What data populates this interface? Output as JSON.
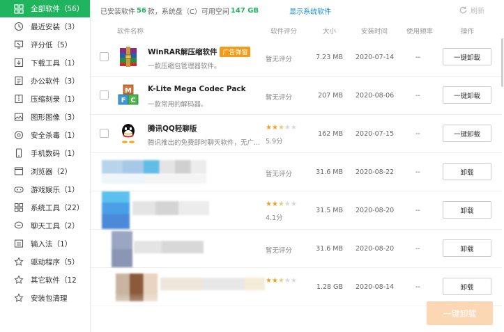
{
  "sidebar": {
    "items": [
      {
        "label": "全部软件（56）",
        "icon": "grid-icon",
        "active": true
      },
      {
        "label": "最近安装（3）",
        "icon": "clock-icon"
      },
      {
        "label": "评分低（5）",
        "icon": "thumb-down-icon"
      },
      {
        "label": "下载工具（1）",
        "icon": "download-icon"
      },
      {
        "label": "办公软件（3）",
        "icon": "briefcase-icon"
      },
      {
        "label": "压缩刻录（1）",
        "icon": "archive-icon"
      },
      {
        "label": "图形图像（3）",
        "icon": "image-icon"
      },
      {
        "label": "安全杀毒（1）",
        "icon": "shield-icon"
      },
      {
        "label": "手机数码（1）",
        "icon": "phone-icon"
      },
      {
        "label": "浏览器（2）",
        "icon": "browser-icon"
      },
      {
        "label": "游戏娱乐（1）",
        "icon": "gamepad-icon"
      },
      {
        "label": "系统工具（22）",
        "icon": "tools-icon"
      },
      {
        "label": "聊天工具（2）",
        "icon": "chat-icon"
      },
      {
        "label": "输入法（1）",
        "icon": "keyboard-icon"
      },
      {
        "label": "驱动程序（5）",
        "icon": "star-icon"
      },
      {
        "label": "其它软件（12",
        "icon": "star-icon"
      },
      {
        "label": "安装包清理",
        "icon": "star-icon"
      }
    ]
  },
  "topbar": {
    "prefix": "已安装软件",
    "count": "56",
    "mid": "款，系统盘（C）可用空间",
    "free_space": "147 GB",
    "show_system_link": "显示系统软件",
    "refresh_label": "刷新"
  },
  "table": {
    "headers": {
      "name": "软件名称",
      "rating": "软件评分",
      "size": "大小",
      "install_date": "安装时间",
      "frequency": "使用频率",
      "action": "操作"
    },
    "rows": [
      {
        "name": "WinRAR解压缩软件",
        "badge": "广告弹窗",
        "desc": "一款压缩包管理器软件。",
        "rating": "暂无评分",
        "size": "7.23 MB",
        "date": "2020-07-14",
        "freq": "--",
        "action": "一键卸载",
        "icon": "winrar-icon"
      },
      {
        "name": "K-Lite Mega Codec Pack",
        "desc": "一款常用的解码器。",
        "rating": "暂无评分",
        "size": "207 MB",
        "date": "2020-08-06",
        "freq": "--",
        "action": "一键卸载",
        "icon": "klite-icon"
      },
      {
        "name": "腾讯QQ轻聊版",
        "desc": "腾讯推出的免费即时聊天软件，无广...",
        "stars": 2.5,
        "score": "5.9分",
        "size": "162 MB",
        "date": "2020-07-15",
        "freq": "--",
        "action": "一键卸载",
        "icon": "qq-icon"
      },
      {
        "rating": "暂无评分",
        "size": "31.6 MB",
        "date": "2020-08-22",
        "freq": "--",
        "action": "卸载"
      },
      {
        "stars": 2.5,
        "score": "4.1分",
        "size": "31.5 MB",
        "date": "2020-08-20",
        "freq": "--",
        "action": "卸载"
      },
      {
        "rating": "暂无评分",
        "size": "31.6 MB",
        "date": "2020-08-20",
        "freq": "--",
        "action": "卸载"
      },
      {
        "stars": 2.5,
        "size": "1.28 GB",
        "date": "2020-08-14",
        "freq": "--",
        "action": "卸载"
      }
    ]
  },
  "bottom_button": "一键卸载",
  "colors": {
    "accent": "#20b45e",
    "link": "#1a8fd6",
    "badge": "#f19c1a",
    "star": "#f0a020",
    "bottom_btn": "#fcd7b4"
  }
}
